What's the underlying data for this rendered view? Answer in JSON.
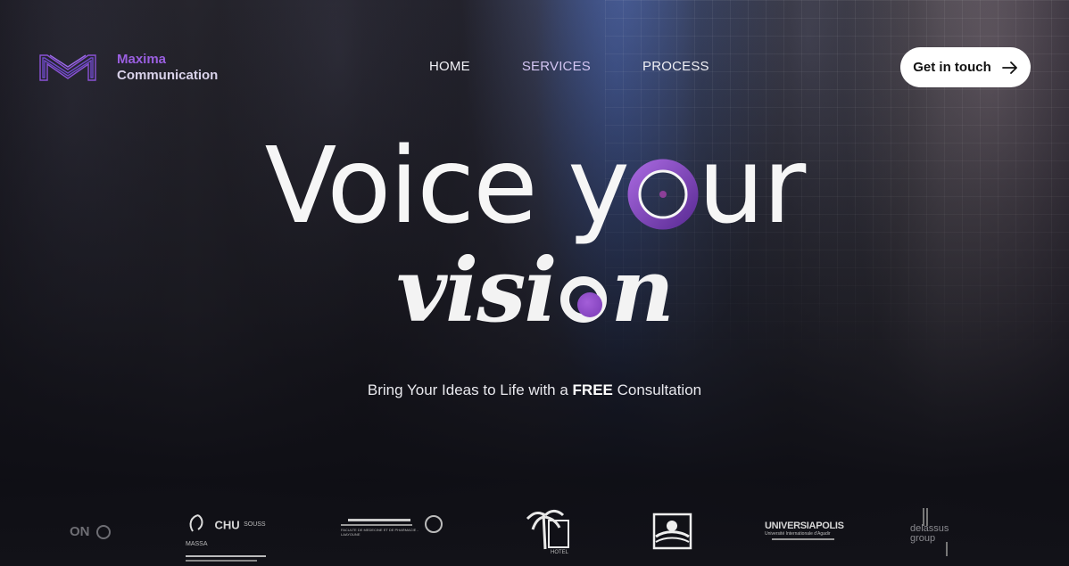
{
  "brand": {
    "line1": "Maxima",
    "line2": "Communication",
    "logo_icon": "maxima-m-logo-icon"
  },
  "nav": {
    "home": "HOME",
    "services": "SERVICES",
    "process": "PROCESS"
  },
  "cta": {
    "label": "Get in touch",
    "icon": "arrow-right-icon"
  },
  "hero": {
    "line1_part1": "Voice y",
    "line1_part2": "ur",
    "line2_part1": "visi",
    "line2_part2": "n",
    "subtitle_before": "Bring Your Ideas to Life with a ",
    "subtitle_bold": "FREE",
    "subtitle_after": " Consultation"
  },
  "clients": {
    "logo1_text": "ON",
    "logo2_title": "CHU",
    "logo2_subtitle": "SOUSS MASSA",
    "logo3_text": "FACULTE DE MEDECINE ET DE PHARMACIE - LAAYOUNE",
    "logo4_text": "HOTEL",
    "logo6_title": "UNIVERSIAPOLIS",
    "logo6_subtitle": "Université Internationale d'Agadir",
    "logo7_text": "delassus group"
  },
  "colors": {
    "accent": "#9a5fe0",
    "background": "#17161d",
    "cta_bg": "#ffffff"
  }
}
